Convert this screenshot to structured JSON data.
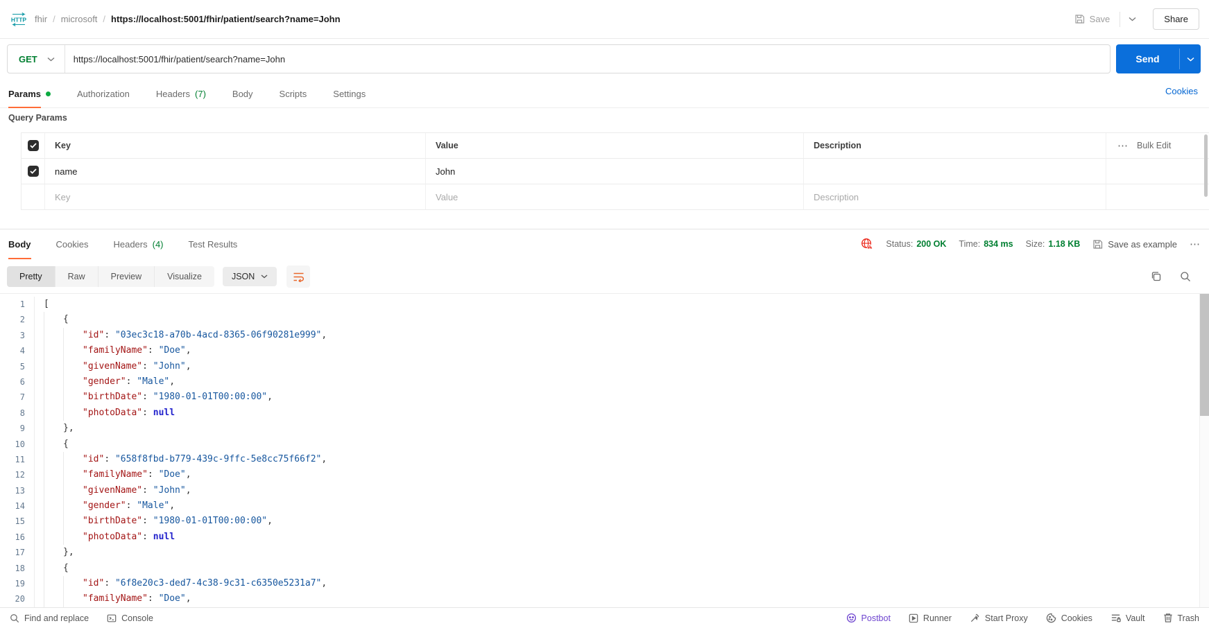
{
  "topbar": {
    "breadcrumb_part1": "fhir",
    "breadcrumb_part2": "microsoft",
    "breadcrumb_sep": "/",
    "request_title": "https://localhost:5001/fhir/patient/search?name=John",
    "save_label": "Save",
    "share_label": "Share"
  },
  "request_bar": {
    "method": "GET",
    "url": "https://localhost:5001/fhir/patient/search?name=John",
    "send_label": "Send"
  },
  "request_tabs": {
    "params": "Params",
    "authorization": "Authorization",
    "headers": "Headers",
    "headers_count": "(7)",
    "body": "Body",
    "scripts": "Scripts",
    "settings": "Settings",
    "cookies_link": "Cookies"
  },
  "query_params": {
    "heading": "Query Params",
    "col_key": "Key",
    "col_value": "Value",
    "col_description": "Description",
    "more": "⋯",
    "bulk_edit": "Bulk Edit",
    "row": {
      "key": "name",
      "value": "John",
      "description": ""
    },
    "placeholder": {
      "key": "Key",
      "value": "Value",
      "description": "Description"
    }
  },
  "response": {
    "tab_body": "Body",
    "tab_cookies": "Cookies",
    "tab_headers": "Headers",
    "tab_headers_count": "(4)",
    "tab_tests": "Test Results",
    "status_label": "Status:",
    "status_value": "200 OK",
    "time_label": "Time:",
    "time_value": "834 ms",
    "size_label": "Size:",
    "size_value": "1.18 KB",
    "save_as_example": "Save as example",
    "more": "⋯",
    "view_pretty": "Pretty",
    "view_raw": "Raw",
    "view_preview": "Preview",
    "view_visualize": "Visualize",
    "format": "JSON"
  },
  "code": {
    "lines": [
      {
        "n": "1",
        "i": 0,
        "t": [
          [
            "p",
            "["
          ]
        ]
      },
      {
        "n": "2",
        "i": 1,
        "t": [
          [
            "p",
            "{"
          ]
        ]
      },
      {
        "n": "3",
        "i": 2,
        "t": [
          [
            "k",
            "\"id\""
          ],
          [
            "p",
            ": "
          ],
          [
            "s",
            "\"03ec3c18-a70b-4acd-8365-06f90281e999\""
          ],
          [
            "p",
            ","
          ]
        ]
      },
      {
        "n": "4",
        "i": 2,
        "t": [
          [
            "k",
            "\"familyName\""
          ],
          [
            "p",
            ": "
          ],
          [
            "s",
            "\"Doe\""
          ],
          [
            "p",
            ","
          ]
        ]
      },
      {
        "n": "5",
        "i": 2,
        "t": [
          [
            "k",
            "\"givenName\""
          ],
          [
            "p",
            ": "
          ],
          [
            "s",
            "\"John\""
          ],
          [
            "p",
            ","
          ]
        ]
      },
      {
        "n": "6",
        "i": 2,
        "t": [
          [
            "k",
            "\"gender\""
          ],
          [
            "p",
            ": "
          ],
          [
            "s",
            "\"Male\""
          ],
          [
            "p",
            ","
          ]
        ]
      },
      {
        "n": "7",
        "i": 2,
        "t": [
          [
            "k",
            "\"birthDate\""
          ],
          [
            "p",
            ": "
          ],
          [
            "s",
            "\"1980-01-01T00:00:00\""
          ],
          [
            "p",
            ","
          ]
        ]
      },
      {
        "n": "8",
        "i": 2,
        "t": [
          [
            "k",
            "\"photoData\""
          ],
          [
            "p",
            ": "
          ],
          [
            "x",
            "null"
          ]
        ]
      },
      {
        "n": "9",
        "i": 1,
        "t": [
          [
            "p",
            "},"
          ]
        ]
      },
      {
        "n": "10",
        "i": 1,
        "t": [
          [
            "p",
            "{"
          ]
        ]
      },
      {
        "n": "11",
        "i": 2,
        "t": [
          [
            "k",
            "\"id\""
          ],
          [
            "p",
            ": "
          ],
          [
            "s",
            "\"658f8fbd-b779-439c-9ffc-5e8cc75f66f2\""
          ],
          [
            "p",
            ","
          ]
        ]
      },
      {
        "n": "12",
        "i": 2,
        "t": [
          [
            "k",
            "\"familyName\""
          ],
          [
            "p",
            ": "
          ],
          [
            "s",
            "\"Doe\""
          ],
          [
            "p",
            ","
          ]
        ]
      },
      {
        "n": "13",
        "i": 2,
        "t": [
          [
            "k",
            "\"givenName\""
          ],
          [
            "p",
            ": "
          ],
          [
            "s",
            "\"John\""
          ],
          [
            "p",
            ","
          ]
        ]
      },
      {
        "n": "14",
        "i": 2,
        "t": [
          [
            "k",
            "\"gender\""
          ],
          [
            "p",
            ": "
          ],
          [
            "s",
            "\"Male\""
          ],
          [
            "p",
            ","
          ]
        ]
      },
      {
        "n": "15",
        "i": 2,
        "t": [
          [
            "k",
            "\"birthDate\""
          ],
          [
            "p",
            ": "
          ],
          [
            "s",
            "\"1980-01-01T00:00:00\""
          ],
          [
            "p",
            ","
          ]
        ]
      },
      {
        "n": "16",
        "i": 2,
        "t": [
          [
            "k",
            "\"photoData\""
          ],
          [
            "p",
            ": "
          ],
          [
            "x",
            "null"
          ]
        ]
      },
      {
        "n": "17",
        "i": 1,
        "t": [
          [
            "p",
            "},"
          ]
        ]
      },
      {
        "n": "18",
        "i": 1,
        "t": [
          [
            "p",
            "{"
          ]
        ]
      },
      {
        "n": "19",
        "i": 2,
        "t": [
          [
            "k",
            "\"id\""
          ],
          [
            "p",
            ": "
          ],
          [
            "s",
            "\"6f8e20c3-ded7-4c38-9c31-c6350e5231a7\""
          ],
          [
            "p",
            ","
          ]
        ]
      },
      {
        "n": "20",
        "i": 2,
        "t": [
          [
            "k",
            "\"familyName\""
          ],
          [
            "p",
            ": "
          ],
          [
            "s",
            "\"Doe\""
          ],
          [
            "p",
            ","
          ]
        ]
      }
    ]
  },
  "footer": {
    "find": "Find and replace",
    "console": "Console",
    "postbot": "Postbot",
    "runner": "Runner",
    "proxy": "Start Proxy",
    "cookies": "Cookies",
    "vault": "Vault",
    "trash": "Trash"
  },
  "colors": {
    "accent_orange": "#ff6c37",
    "green": "#007f31",
    "link_blue": "#0265d2",
    "send_blue": "#0b6fdb",
    "ssl_red": "#eb2013",
    "wrap_icon_orange": "#e9662b",
    "postbot_purple": "#6e44cf",
    "code_key": "#a31515",
    "code_string": "#16569e",
    "code_null": "#2222cc"
  }
}
